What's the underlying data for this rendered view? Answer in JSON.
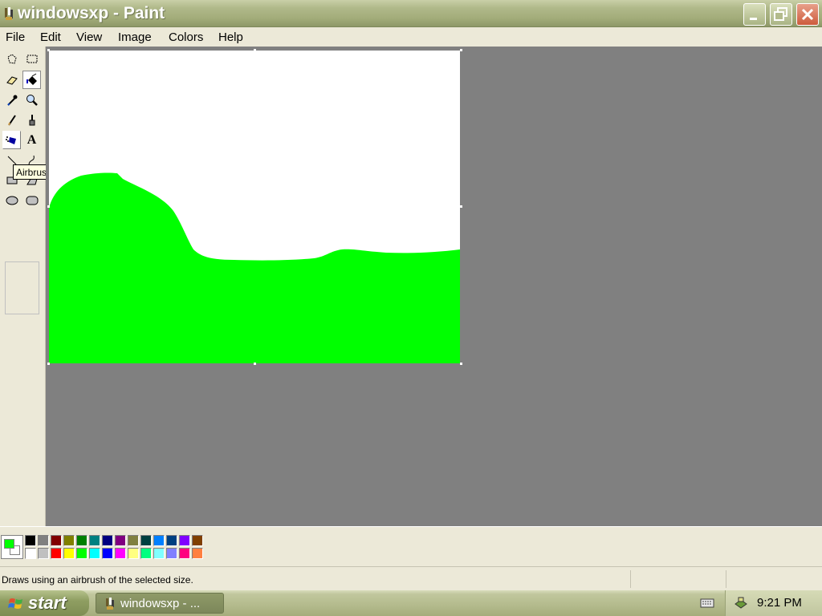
{
  "window": {
    "title": "windowsxp - Paint"
  },
  "menu": [
    "File",
    "Edit",
    "View",
    "Image",
    "Colors",
    "Help"
  ],
  "toolbox": {
    "tools": [
      {
        "name": "free-form-select",
        "icon": "free-form-select-icon"
      },
      {
        "name": "select",
        "icon": "rect-select-icon"
      },
      {
        "name": "eraser",
        "icon": "eraser-icon"
      },
      {
        "name": "fill-with-color",
        "icon": "fill-bucket-icon",
        "selected": true
      },
      {
        "name": "pick-color",
        "icon": "eyedropper-icon"
      },
      {
        "name": "magnifier",
        "icon": "magnifier-icon"
      },
      {
        "name": "pencil",
        "icon": "pencil-icon"
      },
      {
        "name": "brush",
        "icon": "brush-icon"
      },
      {
        "name": "airbrush",
        "icon": "airbrush-icon",
        "hovered": true
      },
      {
        "name": "text",
        "icon": "text-icon"
      },
      {
        "name": "line",
        "icon": "line-icon"
      },
      {
        "name": "curve",
        "icon": "curve-icon"
      },
      {
        "name": "rectangle",
        "icon": "rectangle-icon"
      },
      {
        "name": "polygon",
        "icon": "polygon-icon"
      },
      {
        "name": "ellipse",
        "icon": "ellipse-icon"
      },
      {
        "name": "rounded-rectangle",
        "icon": "rounded-rectangle-icon"
      }
    ],
    "text_tool_glyph": "A",
    "tooltip": "Airbrush"
  },
  "canvas": {
    "background": "#ffffff",
    "fill_color": "#00ff00"
  },
  "colors": {
    "foreground": "#00ff00",
    "background": "#ffffff",
    "palette_top": [
      "#000000",
      "#808080",
      "#800000",
      "#808000",
      "#008000",
      "#008080",
      "#000080",
      "#800080",
      "#808040",
      "#004040",
      "#0080ff",
      "#004080",
      "#8000ff",
      "#804000"
    ],
    "palette_bottom": [
      "#ffffff",
      "#c0c0c0",
      "#ff0000",
      "#ffff00",
      "#00ff00",
      "#00ffff",
      "#0000ff",
      "#ff00ff",
      "#ffff80",
      "#00ff80",
      "#80ffff",
      "#8080ff",
      "#ff0080",
      "#ff8040"
    ]
  },
  "status": {
    "text": "Draws using an airbrush of the selected size."
  },
  "taskbar": {
    "start_label": "start",
    "task_label": "windowsxp - ...",
    "clock": "9:21 PM"
  }
}
